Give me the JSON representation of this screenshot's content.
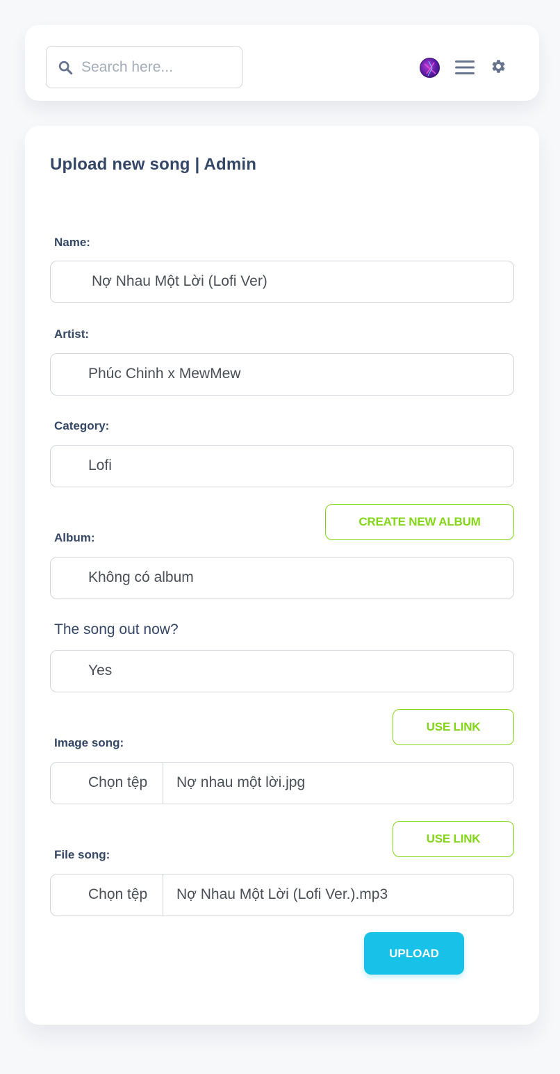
{
  "header": {
    "search": {
      "placeholder": "Search here..."
    },
    "icons": {
      "search": "search-icon",
      "avatar": "avatar",
      "menu": "hamburger-menu-icon",
      "settings": "gear-icon"
    }
  },
  "form": {
    "title": "Upload new song | Admin",
    "name": {
      "label": "Name:",
      "value": "Nợ Nhau Một Lời (Lofi Ver)"
    },
    "artist": {
      "label": "Artist:",
      "value": "Phúc Chinh x MewMew"
    },
    "category": {
      "label": "Category:",
      "value": "Lofi"
    },
    "album": {
      "label": "Album:",
      "value": "Không có album",
      "create_button": "CREATE NEW ALBUM"
    },
    "out_now": {
      "label": "The song out now?",
      "value": "Yes"
    },
    "image": {
      "label": "Image song:",
      "use_link_button": "USE LINK",
      "choose_button": "Chọn tệp",
      "file_name": "Nợ nhau một lời.jpg"
    },
    "file": {
      "label": "File song:",
      "use_link_button": "USE LINK",
      "choose_button": "Chọn tệp",
      "file_name": "Nợ Nhau Một Lời (Lofi Ver.).mp3"
    },
    "upload_button": "UPLOAD"
  },
  "colors": {
    "accent_green": "#82d616",
    "upload_blue": "#17c1e8",
    "text_dark": "#344767"
  }
}
